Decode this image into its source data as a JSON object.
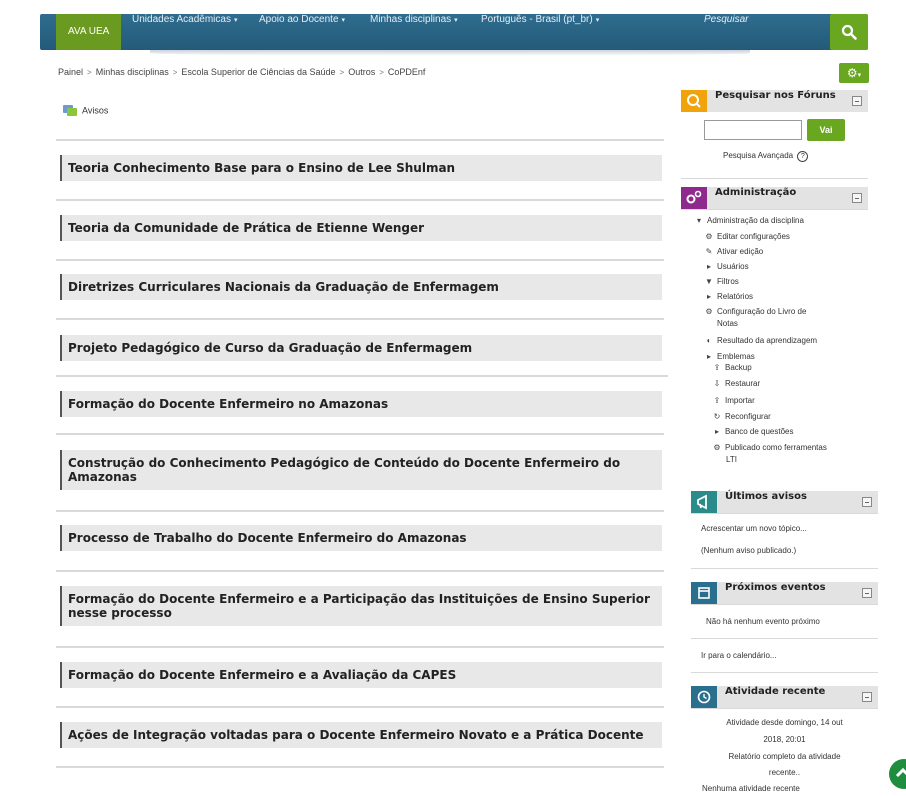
{
  "navbar": {
    "brand": "AVA UEA",
    "menus": [
      "Unidades Acadêmicas",
      "Apoio ao Docente",
      "Minhas disciplinas",
      "Português - Brasil (pt_br)"
    ],
    "search_placeholder": "Pesquisar"
  },
  "breadcrumb": [
    "Painel",
    "Minhas disciplinas",
    "Escola Superior de Ciências da Saúde",
    "Outros",
    "CoPDEnf"
  ],
  "avisos_label": "Avisos",
  "sections": [
    "Teoria Conhecimento Base para o Ensino de Lee Shulman",
    "Teoria da Comunidade de Prática de Etienne Wenger",
    "Diretrizes Curriculares Nacionais da Graduação de Enfermagem",
    "Projeto Pedagógico de Curso da Graduação de Enfermagem",
    "Formação do Docente Enfermeiro no Amazonas",
    "Construção do Conhecimento Pedagógico de Conteúdo do Docente Enfermeiro do Amazonas",
    "Processo de Trabalho do Docente Enfermeiro do Amazonas",
    "Formação do Docente Enfermeiro e a Participação das Instituições de Ensino Superior nesse processo",
    "Formação do Docente Enfermeiro e a Avaliação da CAPES",
    "Ações de Integração voltadas para o Docente Enfermeiro Novato e a Prática Docente"
  ],
  "forum_search": {
    "title": "Pesquisar nos Fóruns",
    "button": "Vai",
    "advanced": "Pesquisa Avançada",
    "input_value": ""
  },
  "admin": {
    "title": "Administração",
    "items": [
      "Administração da disciplina",
      "Editar configurações",
      "Ativar edição",
      "Usuários",
      "Filtros",
      "Relatórios",
      "Configuração do Livro de",
      "Notas",
      "Resultado da aprendizagem",
      "Emblemas",
      "Backup",
      "Restaurar",
      "Importar",
      "Reconfigurar",
      "Banco de questões",
      "Publicado como ferramentas",
      "LTI"
    ]
  },
  "news": {
    "title": "Últimos avisos",
    "add": "Acrescentar um novo tópico...",
    "none": "(Nenhum aviso publicado.)"
  },
  "events": {
    "title": "Próximos eventos",
    "none": "Não há nenhum evento próximo",
    "calendar": "Ir para o calendário..."
  },
  "recent": {
    "title": "Atividade recente",
    "since_1": "Atividade desde domingo, 14 out",
    "since_2": "2018, 20:01",
    "report_1": "Relatório completo da atividade",
    "report_2": "recente..",
    "none": "Nenhuma atividade recente"
  },
  "colors": {
    "navbar": "#2f6d8f",
    "accent_green": "#6aa721",
    "brand_green": "#6a9a1f",
    "forum_icon": "#f0a30a",
    "admin_icon": "#8e2a8e",
    "news_icon": "#2b8a8a",
    "events_icon": "#2b6f8f",
    "recent_icon": "#2b6f8f"
  }
}
